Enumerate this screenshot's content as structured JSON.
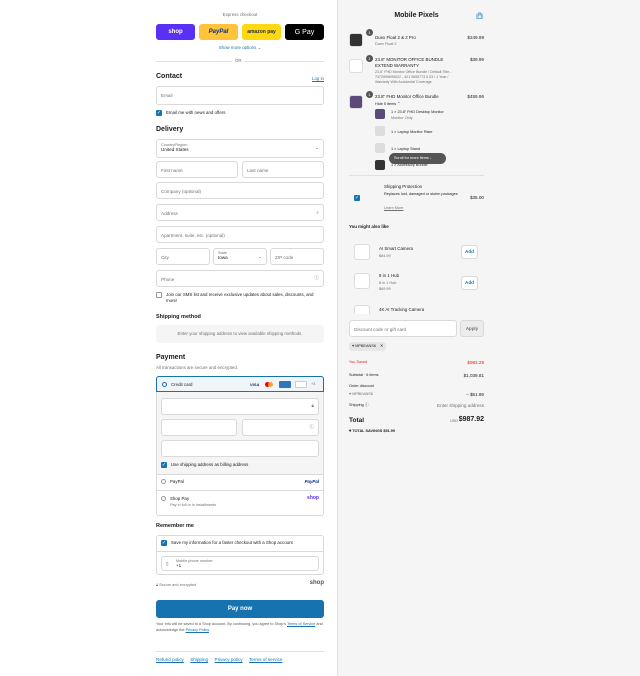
{
  "express": {
    "title": "Express checkout",
    "shop": "shop",
    "paypal": "PayPal",
    "amazon": "amazon pay",
    "gpay": "G Pay",
    "more": "Show more options",
    "or": "OR"
  },
  "contact": {
    "heading": "Contact",
    "login": "Log in",
    "email_placeholder": "Email",
    "news": "Email me with news and offers"
  },
  "delivery": {
    "heading": "Delivery",
    "country_label": "Country/Region",
    "country": "United States",
    "first": "First name",
    "last": "Last name",
    "company": "Company (optional)",
    "address": "Address",
    "apt": "Apartment, suite, etc. (optional)",
    "city": "City",
    "state_label": "State",
    "state": "Iowa",
    "zip": "ZIP code",
    "phone": "Phone",
    "sms": "Join our SMS list and receive exclusive updates about sales, discounts, and more!"
  },
  "shipping": {
    "heading": "Shipping method",
    "placeholder": "Enter your shipping address to view available shipping methods."
  },
  "payment": {
    "heading": "Payment",
    "subtitle": "All transactions are secure and encrypted.",
    "credit": "Credit card",
    "more_cards": "+3",
    "billing": "Use shipping address as billing address",
    "paypal": "PayPal",
    "paypal_logo": "PayPal",
    "shoppay": "Shop Pay",
    "shoppay_sub": "Pay in full or in installments",
    "shoppay_logo": "shop"
  },
  "remember": {
    "heading": "Remember me",
    "save": "Save my information for a faster checkout with a Shop account",
    "mobile_label": "Mobile phone number",
    "mobile": "+1",
    "secure": "Secure and encrypted",
    "shop": "shop"
  },
  "pay_now": "Pay now",
  "legal": {
    "text1": "Your info will be saved to a Shop account. By continuing, you agree to Shop's",
    "terms": "Terms of Service",
    "and": "and acknowledge the",
    "privacy": "Privacy Policy",
    "dot": "."
  },
  "footer": [
    "Refund policy",
    "Shipping",
    "Privacy policy",
    "Terms of service"
  ],
  "store": {
    "name": "Mobile Pixels"
  },
  "items": [
    {
      "qty": "1",
      "title": "Duex Float 2 & 2 Pro",
      "sub": "Duex Float 2",
      "price": "$249.99"
    },
    {
      "qty": "1",
      "title": "23.8\" MONITOR OFFICE BUNDLE EXTEND WARRANTY",
      "sub": "23.8\" FHD Monitor Office Bundle / Default Title - 7472999695022 - 421 9855773 0 03 / 1 Year / Warranty With Accidental Coverage",
      "price": "$39.99"
    },
    {
      "qty": "1",
      "title": "23.8\" FHD Monitor Office Bundle",
      "sub": "Hide 5 items",
      "price": "$459.96"
    }
  ],
  "bundle": [
    {
      "title": "1 × 23.8\" FHD Desktop Monitor",
      "sub": "Monitor Only"
    },
    {
      "title": "1 × Laptop Monitor Riser",
      "sub": ""
    },
    {
      "title": "1 × Laptop Stand",
      "sub": ""
    },
    {
      "title": "1 × Accessory Bundle",
      "sub": ""
    }
  ],
  "scroll_hint": "Scroll for more items",
  "protection": {
    "title": "Shipping Protection",
    "desc": "Replaces lost, damaged or stolen packages",
    "learn": "Learn More",
    "price": "$35.00"
  },
  "upsell": {
    "heading": "You might also like",
    "items": [
      {
        "title": "AI Smart Camera",
        "sub": "",
        "price": "$64.99",
        "add": "Add"
      },
      {
        "title": "8 in 1 Hub",
        "sub": "8 in 1 Hub",
        "price": "$69.99",
        "add": "Add"
      },
      {
        "title": "4K AI Tracking Camera",
        "sub": "",
        "price": "",
        "add": ""
      }
    ]
  },
  "discount": {
    "placeholder": "Discount code or gift card",
    "apply": "Apply",
    "code": "MPBEANS6"
  },
  "summary": {
    "saved_label": "You Saved",
    "saved": "$983.29",
    "subtotal_label": "Subtotal · 6 items",
    "subtotal": "$1,039.81",
    "discount_label": "Order discount",
    "discount_code": "MPBEANS6",
    "discount": "– $51.99",
    "shipping_label": "Shipping",
    "shipping": "Enter shipping address",
    "total_label": "Total",
    "currency": "USD",
    "total": "$987.92",
    "savings_label": "TOTAL SAVINGS",
    "savings": "$51.99"
  },
  "colors": {
    "accent": "#1773b0",
    "shop": "#5a31f4",
    "paypal": "#ffc439",
    "pay_now": "#1773b0",
    "saved": "#e22120"
  }
}
